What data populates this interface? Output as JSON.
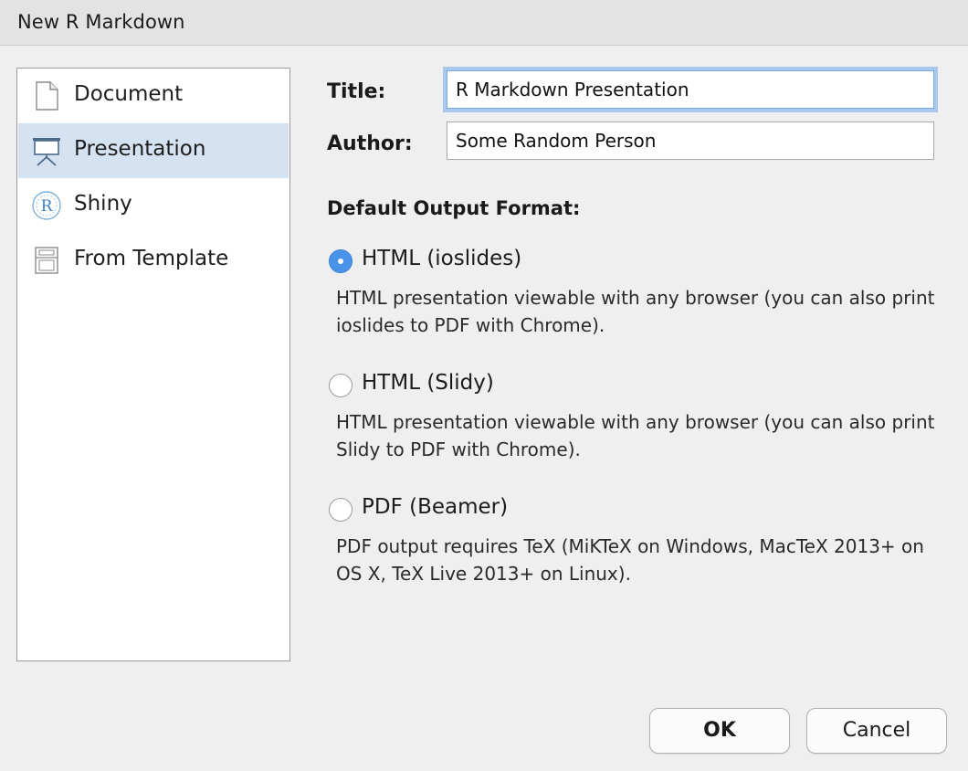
{
  "window": {
    "title": "New R Markdown"
  },
  "sidebar": {
    "items": [
      {
        "label": "Document",
        "icon": "document-icon",
        "selected": false
      },
      {
        "label": "Presentation",
        "icon": "presentation-icon",
        "selected": true
      },
      {
        "label": "Shiny",
        "icon": "shiny-icon",
        "selected": false
      },
      {
        "label": "From Template",
        "icon": "template-icon",
        "selected": false
      }
    ]
  },
  "form": {
    "title_label": "Title:",
    "title_value": "R Markdown Presentation",
    "author_label": "Author:",
    "author_value": "Some Random Person"
  },
  "output": {
    "heading": "Default Output Format:",
    "options": [
      {
        "label": "HTML (ioslides)",
        "description": "HTML presentation viewable with any browser (you can also print ioslides to PDF with Chrome).",
        "checked": true
      },
      {
        "label": "HTML (Slidy)",
        "description": "HTML presentation viewable with any browser (you can also print Slidy to PDF with Chrome).",
        "checked": false
      },
      {
        "label": "PDF (Beamer)",
        "description": "PDF output requires TeX (MiKTeX on Windows, MacTeX 2013+ on OS X, TeX Live 2013+ on Linux).",
        "checked": false
      }
    ]
  },
  "buttons": {
    "ok": "OK",
    "cancel": "Cancel"
  },
  "colors": {
    "accent": "#4a93ea",
    "selection": "#d4e2f1",
    "focus_ring": "#a9c8ee"
  }
}
